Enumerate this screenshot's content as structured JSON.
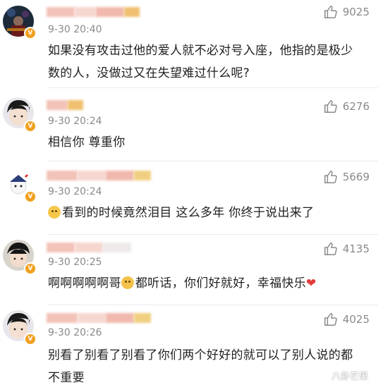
{
  "comments": [
    {
      "timestamp": "9-30 20:40",
      "likes": "9025",
      "text": "如果没有攻击过他的爱人就不必对号入座，他指的是极少数的人，没做过又在失望难过什么呢?"
    },
    {
      "timestamp": "9-30 20:24",
      "likes": "6276",
      "text": "相信你 尊重你"
    },
    {
      "timestamp": "9-30 20:24",
      "likes": "5669",
      "text": "看到的时候竟然泪目 这么多年 你终于说出来了"
    },
    {
      "timestamp": "9-30 20:25",
      "likes": "4135",
      "text_a": "啊啊啊啊啊哥",
      "text_b": "都听话，你们好就好，幸福快乐"
    },
    {
      "timestamp": "9-30 20:26",
      "likes": "4025",
      "text": "别看了别看了别看了你们两个好好的就可以了别人说的都不重要"
    }
  ],
  "watermark": "八卦芒果",
  "colors": {
    "badge": "#f0a020",
    "meta": "#8a8a8a",
    "heart": "#e23b3b"
  }
}
